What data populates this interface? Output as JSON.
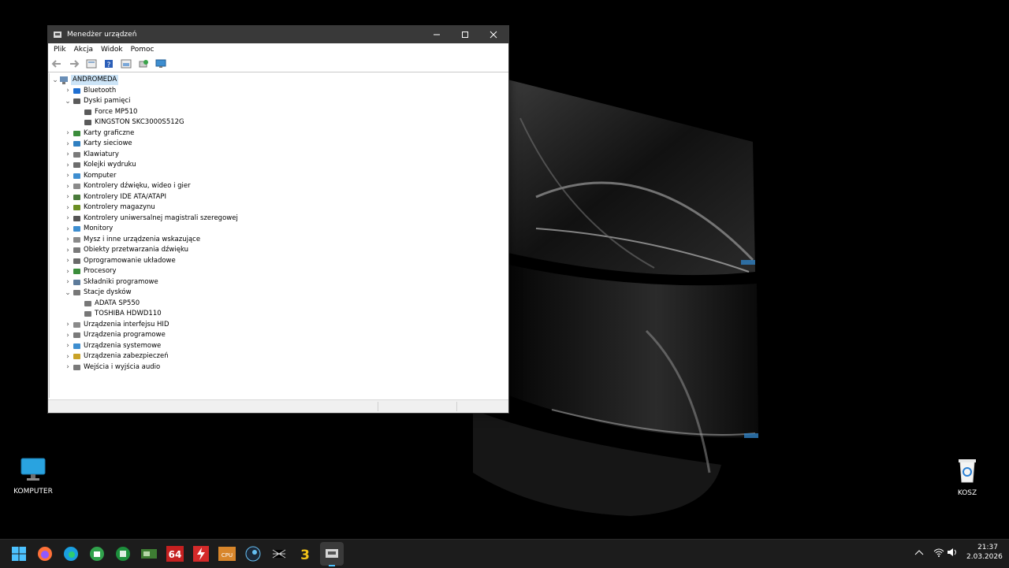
{
  "desktop": {
    "icons": [
      {
        "label": "KOMPUTER",
        "icon": "monitor-icon"
      },
      {
        "label": "KOSZ",
        "icon": "recycle-bin-icon"
      }
    ]
  },
  "window": {
    "title": "Menedżer urządzeń",
    "controls": [
      "minimize",
      "maximize",
      "close"
    ],
    "menu": [
      "Plik",
      "Akcja",
      "Widok",
      "Pomoc"
    ],
    "toolbar": [
      "back-icon",
      "forward-icon",
      "properties-icon",
      "help-icon",
      "show-hide-icon",
      "scan-hardware-icon",
      "monitor-display-icon"
    ]
  },
  "tree": {
    "root": "ANDROMEDA",
    "items": [
      {
        "label": "Bluetooth",
        "level": 1,
        "expanded": false,
        "icon": "bluetooth-icon"
      },
      {
        "label": "Dyski pamięci",
        "level": 1,
        "expanded": true,
        "icon": "disk-drive-icon"
      },
      {
        "label": "Force MP510",
        "level": 2,
        "icon": "disk-drive-icon"
      },
      {
        "label": "KINGSTON SKC3000S512G",
        "level": 2,
        "icon": "disk-drive-icon"
      },
      {
        "label": "Karty graficzne",
        "level": 1,
        "expanded": false,
        "icon": "display-adapter-icon"
      },
      {
        "label": "Karty sieciowe",
        "level": 1,
        "expanded": false,
        "icon": "network-adapter-icon"
      },
      {
        "label": "Klawiatury",
        "level": 1,
        "expanded": false,
        "icon": "keyboard-icon"
      },
      {
        "label": "Kolejki wydruku",
        "level": 1,
        "expanded": false,
        "icon": "printer-icon"
      },
      {
        "label": "Komputer",
        "level": 1,
        "expanded": false,
        "icon": "computer-icon"
      },
      {
        "label": "Kontrolery dźwięku, wideo i gier",
        "level": 1,
        "expanded": false,
        "icon": "speaker-icon"
      },
      {
        "label": "Kontrolery IDE ATA/ATAPI",
        "level": 1,
        "expanded": false,
        "icon": "ide-controller-icon"
      },
      {
        "label": "Kontrolery magazynu",
        "level": 1,
        "expanded": false,
        "icon": "storage-controller-icon"
      },
      {
        "label": "Kontrolery uniwersalnej magistrali szeregowej",
        "level": 1,
        "expanded": false,
        "icon": "usb-icon"
      },
      {
        "label": "Monitory",
        "level": 1,
        "expanded": false,
        "icon": "monitor-icon"
      },
      {
        "label": "Mysz i inne urządzenia wskazujące",
        "level": 1,
        "expanded": false,
        "icon": "mouse-icon"
      },
      {
        "label": "Obiekty przetwarzania dźwięku",
        "level": 1,
        "expanded": false,
        "icon": "audio-processing-icon"
      },
      {
        "label": "Oprogramowanie układowe",
        "level": 1,
        "expanded": false,
        "icon": "firmware-icon"
      },
      {
        "label": "Procesory",
        "level": 1,
        "expanded": false,
        "icon": "processor-icon"
      },
      {
        "label": "Składniki programowe",
        "level": 1,
        "expanded": false,
        "icon": "software-component-icon"
      },
      {
        "label": "Stacje dysków",
        "level": 1,
        "expanded": true,
        "icon": "drive-icon"
      },
      {
        "label": "ADATA SP550",
        "level": 2,
        "icon": "drive-icon"
      },
      {
        "label": "TOSHIBA HDWD110",
        "level": 2,
        "icon": "drive-icon"
      },
      {
        "label": "Urządzenia interfejsu HID",
        "level": 1,
        "expanded": false,
        "icon": "hid-icon"
      },
      {
        "label": "Urządzenia programowe",
        "level": 1,
        "expanded": false,
        "icon": "software-device-icon"
      },
      {
        "label": "Urządzenia systemowe",
        "level": 1,
        "expanded": false,
        "icon": "system-device-icon"
      },
      {
        "label": "Urządzenia zabezpieczeń",
        "level": 1,
        "expanded": false,
        "icon": "security-device-icon"
      },
      {
        "label": "Wejścia i wyjścia audio",
        "level": 1,
        "expanded": false,
        "icon": "audio-io-icon"
      }
    ]
  },
  "taskbar": {
    "apps": [
      "start-icon",
      "firefox-icon",
      "edge-icon",
      "store-icon",
      "excel-icon",
      "gpu-z-icon",
      "aida64-icon",
      "flash-icon",
      "cpu-z-icon",
      "steam-icon",
      "spider-icon",
      "three-icon",
      "device-manager-icon"
    ],
    "aida_label": "64",
    "cpu_label": "CPU",
    "three_label": "3",
    "tray": {
      "time": "21:37",
      "date": "2.03.2026"
    }
  }
}
